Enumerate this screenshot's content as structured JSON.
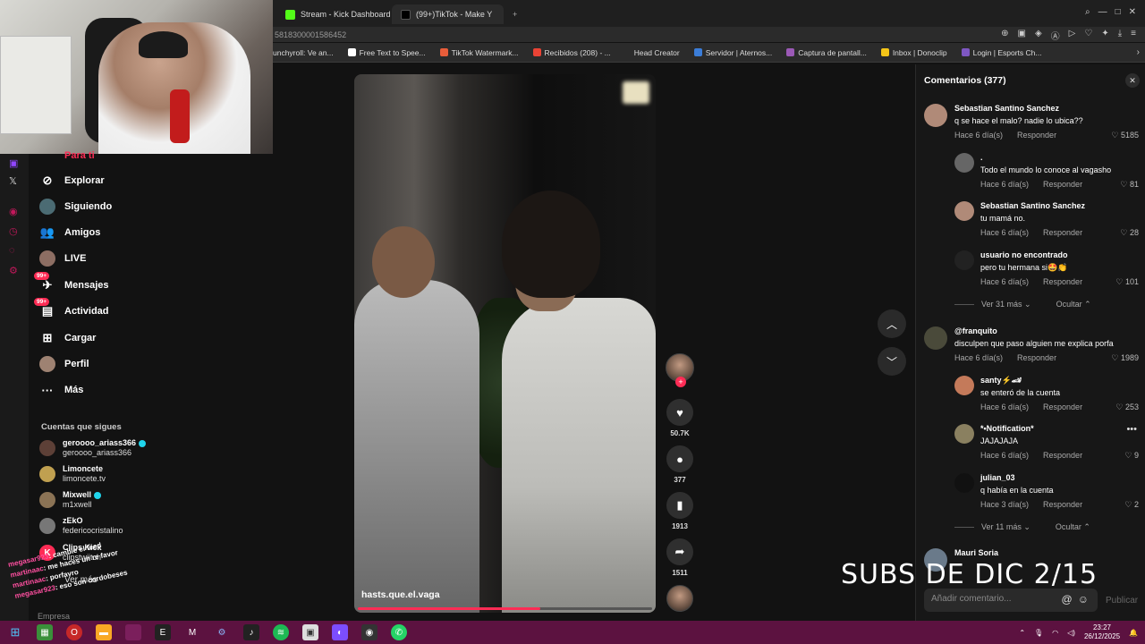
{
  "browser": {
    "tabs": [
      {
        "label": "Stream - Kick Dashboard",
        "active": false
      },
      {
        "label": "(99+)TikTok - Make Y",
        "active": true
      }
    ],
    "url": "5818300001586452",
    "bookmarks": [
      "unchyroll: Ve an...",
      "Free Text to Spee...",
      "TikTok Watermark...",
      "Recibidos (208) - ...",
      "Head Creator",
      "Servidor | Aternos...",
      "Captura de pantall...",
      "Inbox | Donoclip",
      "Login | Esports Ch..."
    ]
  },
  "sidebar": {
    "partial_top": "Para ti",
    "items": [
      {
        "label": "Explorar",
        "icon": "compass-icon"
      },
      {
        "label": "Siguiendo",
        "icon": "following-icon"
      },
      {
        "label": "Amigos",
        "icon": "friends-icon"
      },
      {
        "label": "LIVE",
        "icon": "live-icon"
      },
      {
        "label": "Mensajes",
        "icon": "messages-icon",
        "badge": "99+"
      },
      {
        "label": "Actividad",
        "icon": "activity-icon",
        "badge": "99+"
      },
      {
        "label": "Cargar",
        "icon": "upload-icon"
      },
      {
        "label": "Perfil",
        "icon": "profile-icon"
      },
      {
        "label": "Más",
        "icon": "more-icon"
      }
    ],
    "following_title": "Cuentas que sigues",
    "following": [
      {
        "name": "geroooo_ariass366",
        "handle": "geroooo_ariass366",
        "verified": true
      },
      {
        "name": "Limoncete",
        "handle": "limoncete.tv",
        "verified": false
      },
      {
        "name": "Mixwell",
        "handle": "m1xwell",
        "verified": true
      },
      {
        "name": "zEkO",
        "handle": "federicocristalino",
        "verified": false
      },
      {
        "name": "Clips Kick",
        "handle": "clipstwiitch",
        "verified": false
      }
    ],
    "see_more": "Ver más",
    "partial_bottom": "Empresa"
  },
  "chat": [
    {
      "user": "megasar923",
      "msg": ": cambie el feed"
    },
    {
      "user": "martinaac",
      "msg": ": me haces un re favor"
    },
    {
      "user": "martinaac",
      "msg": ": porfavro"
    },
    {
      "user": "megasar923",
      "msg": ": eso son cordobeses"
    }
  ],
  "video": {
    "caption": "hasts.que.el.vaga",
    "progress": 0.62
  },
  "actions": {
    "likes": "50.7K",
    "comments": "377",
    "saves": "1913",
    "shares": "1511"
  },
  "comments_panel": {
    "title": "Comentarios (377)",
    "reply_label": "Responder",
    "comments": [
      {
        "user": "Sebastian Santino Sanchez",
        "text": "q se hace el malo? nadie lo ubica??",
        "time": "Hace 6 día(s)",
        "likes": "5185",
        "reply": false
      },
      {
        "user": ".",
        "text": "Todo el mundo lo conoce al vagasho",
        "time": "Hace 6 día(s)",
        "likes": "81",
        "reply": true
      },
      {
        "user": "Sebastian Santino Sanchez",
        "text": "tu mamá no.",
        "time": "Hace 6 día(s)",
        "likes": "28",
        "reply": true
      },
      {
        "user": "usuario no encontrado",
        "text": "pero tu hermana si🤩👏",
        "time": "Hace 6 día(s)",
        "likes": "101",
        "reply": true
      },
      {
        "user": "@franquito",
        "text": "disculpen que paso alguien me explica porfa",
        "time": "Hace 6 día(s)",
        "likes": "1989",
        "reply": false
      },
      {
        "user": "santy⚡🏎",
        "text": "se enteró de la cuenta",
        "time": "Hace 6 día(s)",
        "likes": "253",
        "reply": true
      },
      {
        "user": "*•Notification*",
        "text": "JAJAJAJA",
        "time": "Hace 6 día(s)",
        "likes": "9",
        "reply": true
      },
      {
        "user": "julian_03",
        "text": "q había en la cuenta",
        "time": "Hace 3 día(s)",
        "likes": "2",
        "reply": true
      },
      {
        "user": "Mauri Soria",
        "text": "",
        "time": "",
        "likes": "",
        "reply": false
      }
    ],
    "more_replies_1": "Ver 31 más",
    "more_replies_2": "Ver 11 más",
    "hide_label": "Ocultar",
    "input_placeholder": "Añadir comentario...",
    "post_label": "Publicar"
  },
  "overlay_text": "SUBS  DE DIC 2/15",
  "taskbar": {
    "time": "23:27",
    "date": "26/12/2025"
  }
}
